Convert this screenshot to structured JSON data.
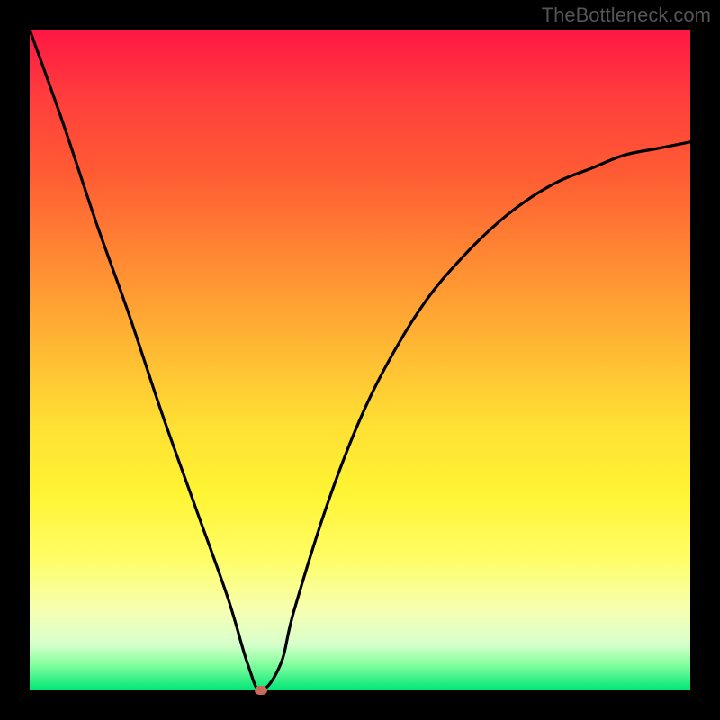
{
  "watermark": "TheBottleneck.com",
  "chart_data": {
    "type": "line",
    "title": "",
    "xlabel": "",
    "ylabel": "",
    "xlim": [
      0,
      100
    ],
    "ylim": [
      0,
      100
    ],
    "grid": false,
    "legend": false,
    "series": [
      {
        "name": "bottleneck-curve",
        "x": [
          0,
          5,
          10,
          15,
          20,
          25,
          30,
          33,
          35,
          38,
          40,
          45,
          50,
          55,
          60,
          65,
          70,
          75,
          80,
          85,
          90,
          95,
          100
        ],
        "y": [
          100,
          86,
          71,
          57,
          42,
          28,
          14,
          4,
          0,
          4,
          12,
          28,
          41,
          51,
          59,
          65,
          70,
          74,
          77,
          79,
          81,
          82,
          83
        ]
      }
    ],
    "marker": {
      "x": 35,
      "y": 0,
      "color": "#c96a5a"
    },
    "background_gradient": {
      "top": "#ff1744",
      "mid": "#ffe033",
      "bottom": "#00e676"
    }
  }
}
